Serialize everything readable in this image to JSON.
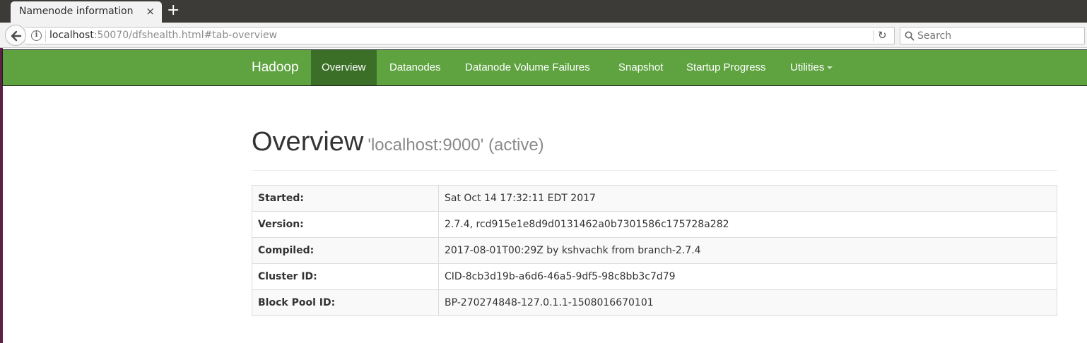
{
  "browser": {
    "tab_title": "Namenode information",
    "tab_close": "×",
    "new_tab": "+",
    "url_host": "localhost",
    "url_rest": ":50070/dfshealth.html#tab-overview",
    "info_glyph": "i",
    "reload_glyph": "↻",
    "search_placeholder": "Search"
  },
  "navbar": {
    "brand": "Hadoop",
    "items": [
      {
        "label": "Overview",
        "active": true
      },
      {
        "label": "Datanodes"
      },
      {
        "label": "Datanode Volume Failures"
      },
      {
        "label": "Snapshot"
      },
      {
        "label": "Startup Progress"
      },
      {
        "label": "Utilities",
        "dropdown": true
      }
    ]
  },
  "page": {
    "title": "Overview",
    "subtitle": "'localhost:9000' (active)"
  },
  "info_table": [
    {
      "label": "Started:",
      "value": "Sat Oct 14 17:32:11 EDT 2017"
    },
    {
      "label": "Version:",
      "value": "2.7.4, rcd915e1e8d9d0131462a0b7301586c175728a282"
    },
    {
      "label": "Compiled:",
      "value": "2017-08-01T00:29Z by kshvachk from branch-2.7.4"
    },
    {
      "label": "Cluster ID:",
      "value": "CID-8cb3d19b-a6d6-46a5-9df5-98c8bb3c7d79"
    },
    {
      "label": "Block Pool ID:",
      "value": "BP-270274848-127.0.1.1-1508016670101"
    }
  ],
  "colors": {
    "navbar_bg": "#5fa341",
    "navbar_active": "#3b6f28"
  }
}
